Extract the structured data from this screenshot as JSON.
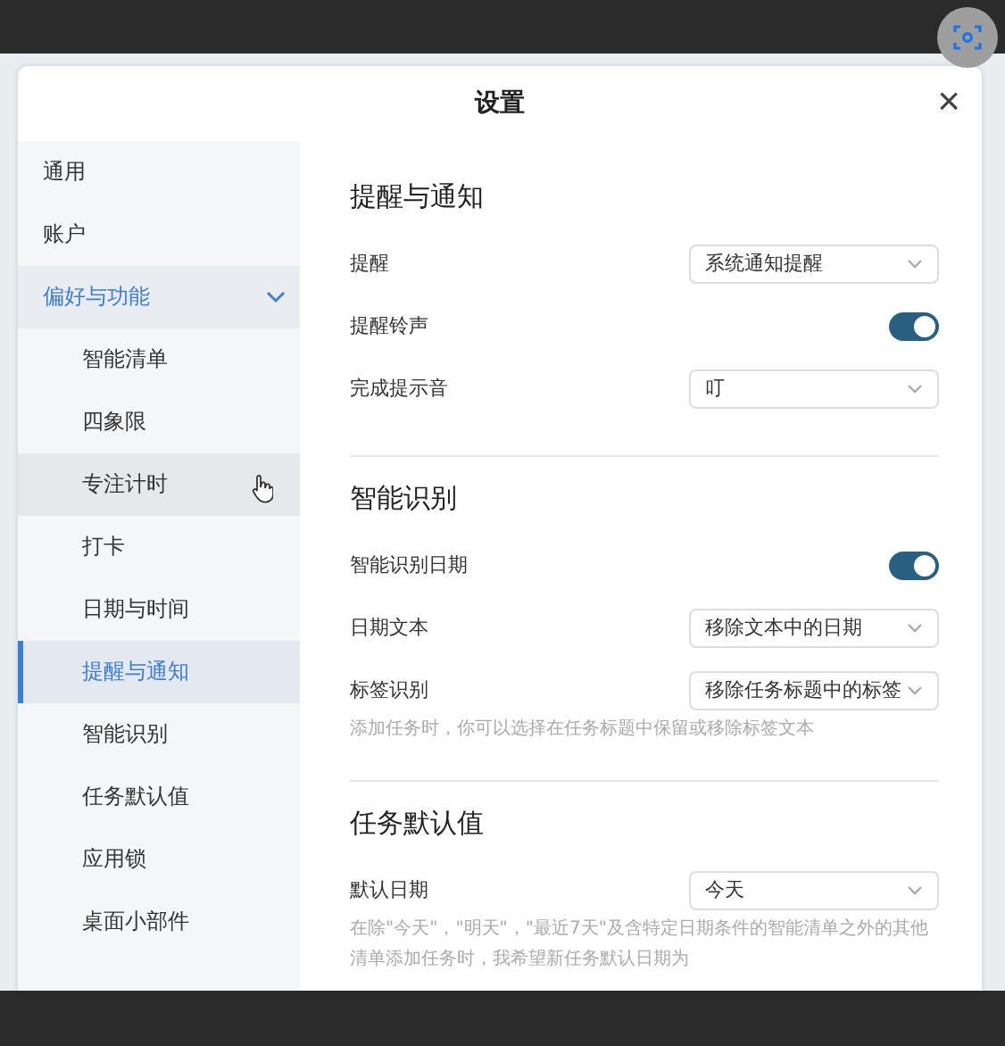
{
  "window": {
    "title": "设置",
    "close": "×"
  },
  "sidebar": {
    "items": [
      {
        "label": "通用",
        "selected": false
      },
      {
        "label": "账户",
        "selected": false
      },
      {
        "label": "偏好与功能",
        "selected": false,
        "expanded": true,
        "children": [
          {
            "label": "智能清单",
            "selected": false,
            "hovered": false
          },
          {
            "label": "四象限",
            "selected": false,
            "hovered": false
          },
          {
            "label": "专注计时",
            "selected": false,
            "hovered": true
          },
          {
            "label": "打卡",
            "selected": false,
            "hovered": false
          },
          {
            "label": "日期与时间",
            "selected": false,
            "hovered": false
          },
          {
            "label": "提醒与通知",
            "selected": true,
            "hovered": false
          },
          {
            "label": "智能识别",
            "selected": false,
            "hovered": false
          },
          {
            "label": "任务默认值",
            "selected": false,
            "hovered": false
          },
          {
            "label": "应用锁",
            "selected": false,
            "hovered": false
          },
          {
            "label": "桌面小部件",
            "selected": false,
            "hovered": false
          }
        ]
      }
    ]
  },
  "sections": [
    {
      "title": "提醒与通知",
      "rows": [
        {
          "kind": "select",
          "label": "提醒",
          "value": "系统通知提醒"
        },
        {
          "kind": "toggle",
          "label": "提醒铃声",
          "on": true
        },
        {
          "kind": "select",
          "label": "完成提示音",
          "value": "叮"
        }
      ]
    },
    {
      "title": "智能识别",
      "rows": [
        {
          "kind": "toggle",
          "label": "智能识别日期",
          "on": true
        },
        {
          "kind": "select",
          "label": "日期文本",
          "value": "移除文本中的日期"
        },
        {
          "kind": "select",
          "label": "标签识别",
          "value": "移除任务标题中的标签"
        },
        {
          "kind": "note",
          "text": "添加任务时，你可以选择在任务标题中保留或移除标签文本"
        }
      ]
    },
    {
      "title": "任务默认值",
      "rows": [
        {
          "kind": "select",
          "label": "默认日期",
          "value": "今天"
        },
        {
          "kind": "note",
          "text": "在除\"今天\"，\"明天\"，\"最近7天\"及含特定日期条件的智能清单之外的其他清单添加任务时，我希望新任务默认日期为"
        }
      ]
    }
  ]
}
